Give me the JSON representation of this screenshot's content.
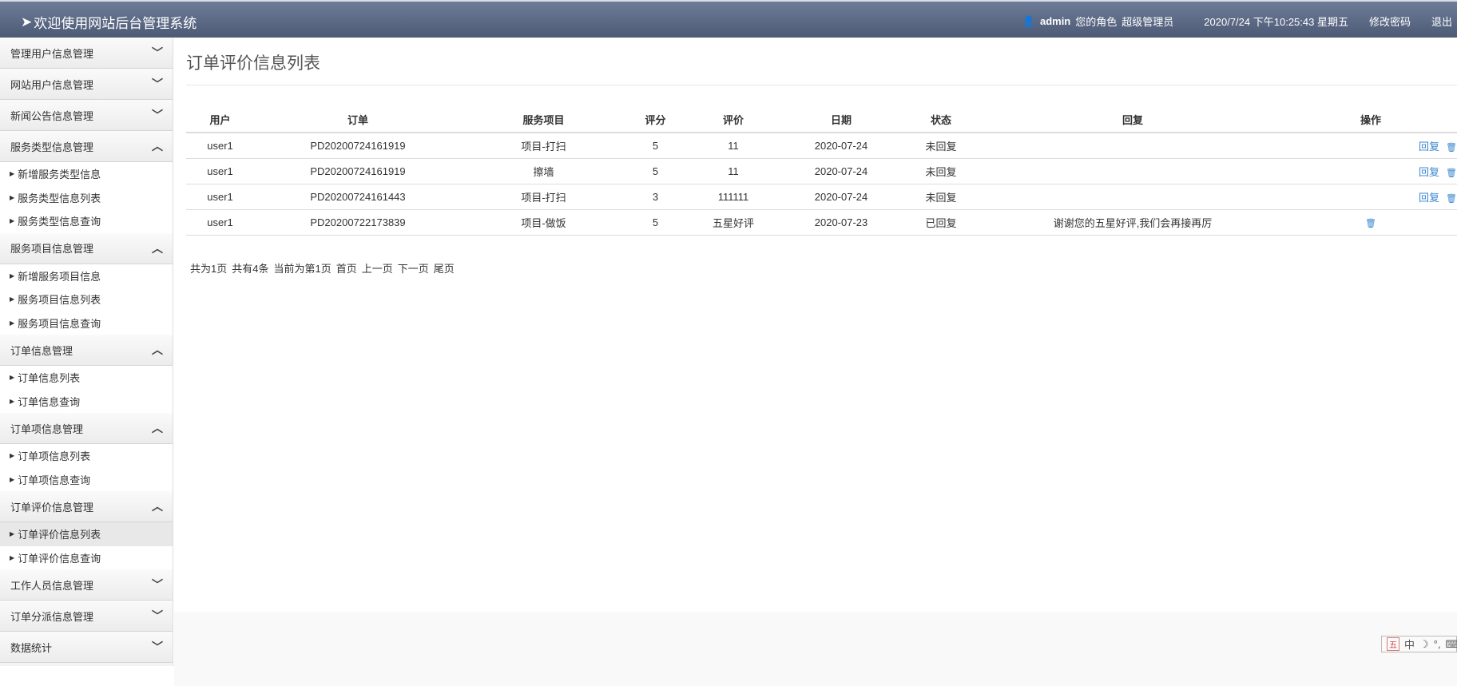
{
  "header": {
    "title": "欢迎使用网站后台管理系统",
    "user": "admin",
    "role_label": "您的角色",
    "role": "超级管理员",
    "datetime": "2020/7/24 下午10:25:43 星期五",
    "change_password": "修改密码",
    "logout": "退出"
  },
  "sidebar": [
    {
      "label": "管理用户信息管理",
      "expanded": false,
      "items": []
    },
    {
      "label": "网站用户信息管理",
      "expanded": false,
      "items": []
    },
    {
      "label": "新闻公告信息管理",
      "expanded": false,
      "items": []
    },
    {
      "label": "服务类型信息管理",
      "expanded": true,
      "items": [
        "新增服务类型信息",
        "服务类型信息列表",
        "服务类型信息查询"
      ]
    },
    {
      "label": "服务项目信息管理",
      "expanded": true,
      "items": [
        "新增服务项目信息",
        "服务项目信息列表",
        "服务项目信息查询"
      ]
    },
    {
      "label": "订单信息管理",
      "expanded": true,
      "items": [
        "订单信息列表",
        "订单信息查询"
      ]
    },
    {
      "label": "订单项信息管理",
      "expanded": true,
      "items": [
        "订单项信息列表",
        "订单项信息查询"
      ]
    },
    {
      "label": "订单评价信息管理",
      "expanded": true,
      "items": [
        "订单评价信息列表",
        "订单评价信息查询"
      ],
      "active": "订单评价信息列表"
    },
    {
      "label": "工作人员信息管理",
      "expanded": false,
      "items": []
    },
    {
      "label": "订单分派信息管理",
      "expanded": false,
      "items": []
    },
    {
      "label": "数据统计",
      "expanded": false,
      "items": []
    }
  ],
  "page_title": "订单评价信息列表",
  "table": {
    "columns": [
      "用户",
      "订单",
      "服务项目",
      "评分",
      "评价",
      "日期",
      "状态",
      "回复",
      "操作"
    ],
    "rows": [
      {
        "user": "user1",
        "order": "PD20200724161919",
        "item": "项目-打扫",
        "score": "5",
        "comment": "11",
        "date": "2020-07-24",
        "status": "未回复",
        "reply": "",
        "action_reply": "回复"
      },
      {
        "user": "user1",
        "order": "PD20200724161919",
        "item": "擦墙",
        "score": "5",
        "comment": "11",
        "date": "2020-07-24",
        "status": "未回复",
        "reply": "",
        "action_reply": "回复"
      },
      {
        "user": "user1",
        "order": "PD20200724161443",
        "item": "项目-打扫",
        "score": "3",
        "comment": "111111",
        "date": "2020-07-24",
        "status": "未回复",
        "reply": "",
        "action_reply": "回复"
      },
      {
        "user": "user1",
        "order": "PD20200722173839",
        "item": "项目-做饭",
        "score": "5",
        "comment": "五星好评",
        "date": "2020-07-23",
        "status": "已回复",
        "reply": "谢谢您的五星好评,我们会再接再厉",
        "action_reply": ""
      }
    ]
  },
  "pager": [
    "共为1页",
    "共有4条",
    "当前为第1页",
    "首页",
    "上一页",
    "下一页",
    "尾页"
  ],
  "ime": {
    "mode": "中",
    "punct": "°,"
  },
  "colors": {
    "header": "#5d6b87",
    "link": "#3a87d0"
  }
}
